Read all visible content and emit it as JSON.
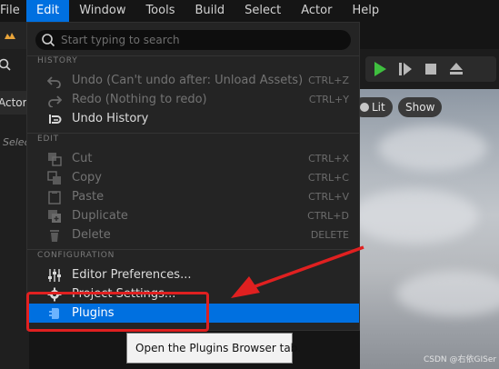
{
  "menubar": {
    "items": [
      "File",
      "Edit",
      "Window",
      "Tools",
      "Build",
      "Select",
      "Actor",
      "Help"
    ],
    "active_index": 1
  },
  "left_panel": {
    "tab_label": "Actors",
    "hint": "Selec"
  },
  "viewport": {
    "lit_label": "Lit",
    "show_label": "Show"
  },
  "dropdown": {
    "search_placeholder": "Start typing to search",
    "sections": [
      {
        "header": "HISTORY",
        "entries": [
          {
            "label": "Undo (Can't undo after: Unload Assets)",
            "shortcut": "CTRL+Z",
            "icon": "undo-icon",
            "enabled": false
          },
          {
            "label": "Redo (Nothing to redo)",
            "shortcut": "CTRL+Y",
            "icon": "redo-icon",
            "enabled": false
          },
          {
            "label": "Undo History",
            "shortcut": "",
            "icon": "undo-history-icon",
            "enabled": true
          }
        ]
      },
      {
        "header": "EDIT",
        "entries": [
          {
            "label": "Cut",
            "shortcut": "CTRL+X",
            "icon": "cut-icon",
            "enabled": false
          },
          {
            "label": "Copy",
            "shortcut": "CTRL+C",
            "icon": "copy-icon",
            "enabled": false
          },
          {
            "label": "Paste",
            "shortcut": "CTRL+V",
            "icon": "paste-icon",
            "enabled": false
          },
          {
            "label": "Duplicate",
            "shortcut": "CTRL+D",
            "icon": "duplicate-icon",
            "enabled": false
          },
          {
            "label": "Delete",
            "shortcut": "DELETE",
            "icon": "delete-icon",
            "enabled": false
          }
        ]
      },
      {
        "header": "CONFIGURATION",
        "entries": [
          {
            "label": "Editor Preferences...",
            "shortcut": "",
            "icon": "sliders-icon",
            "enabled": true
          },
          {
            "label": "Project Settings...",
            "shortcut": "",
            "icon": "gear-icon",
            "enabled": true
          },
          {
            "label": "Plugins",
            "shortcut": "",
            "icon": "plugin-icon",
            "enabled": true,
            "highlighted": true
          }
        ]
      }
    ]
  },
  "tooltip": {
    "text": "Open the Plugins Browser tab."
  },
  "watermark": "CSDN @右依GISer",
  "colors": {
    "highlight": "#0070e0",
    "annotation": "#e02020",
    "play_green": "#3fbf3f"
  }
}
